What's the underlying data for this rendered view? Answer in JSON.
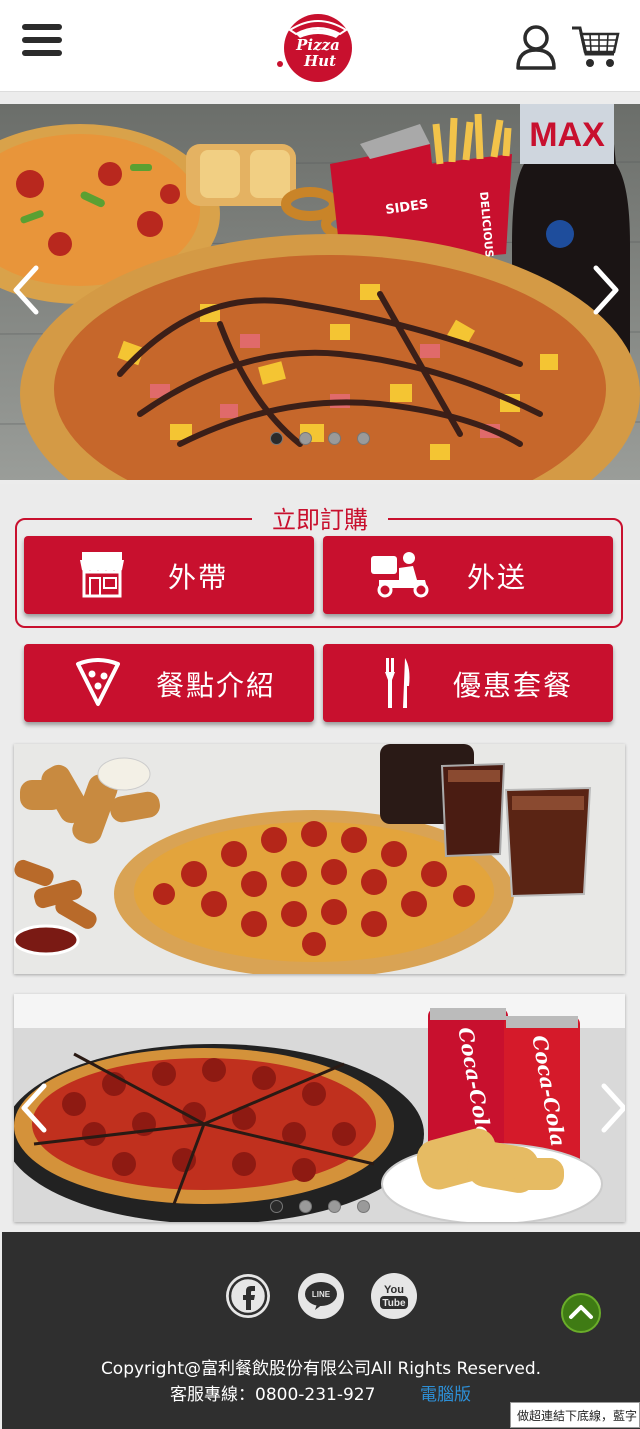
{
  "header": {
    "logo_text_line1": "Pizza",
    "logo_text_line2": "Hut",
    "menu_icon": "hamburger-menu-icon",
    "user_icon": "user-icon",
    "cart_icon": "shopping-cart-icon"
  },
  "hero": {
    "drink_label": "MAX",
    "box_text": "DELICIOUS",
    "box_side_text": "SIDES INSIDE",
    "slides_total": 4,
    "active_slide": 1
  },
  "order": {
    "title": "立即訂購",
    "takeaway_label": "外帶",
    "delivery_label": "外送",
    "menu_label": "餐點介紹",
    "deals_label": "優惠套餐"
  },
  "promo2": {
    "can_text": "Coca-Cola",
    "slides_total": 4,
    "active_slide": 1
  },
  "footer": {
    "copyright": "Copyright@富利餐飲股份有限公司All Rights Reserved.",
    "service_hotline": "客服專線：0800-231-927",
    "desktop_link": "電腦版",
    "social": [
      "facebook-icon",
      "line-icon",
      "youtube-icon"
    ],
    "youtube_line1": "You",
    "youtube_line2": "Tube",
    "line_text": "LINE"
  },
  "tooltip": "做超連結下底線，藍字",
  "colors": {
    "brand_red": "#c8102e",
    "footer_bg": "#2f2f2f",
    "link_blue": "#2d8fd6",
    "scroll_top_green": "#3f7b14"
  }
}
